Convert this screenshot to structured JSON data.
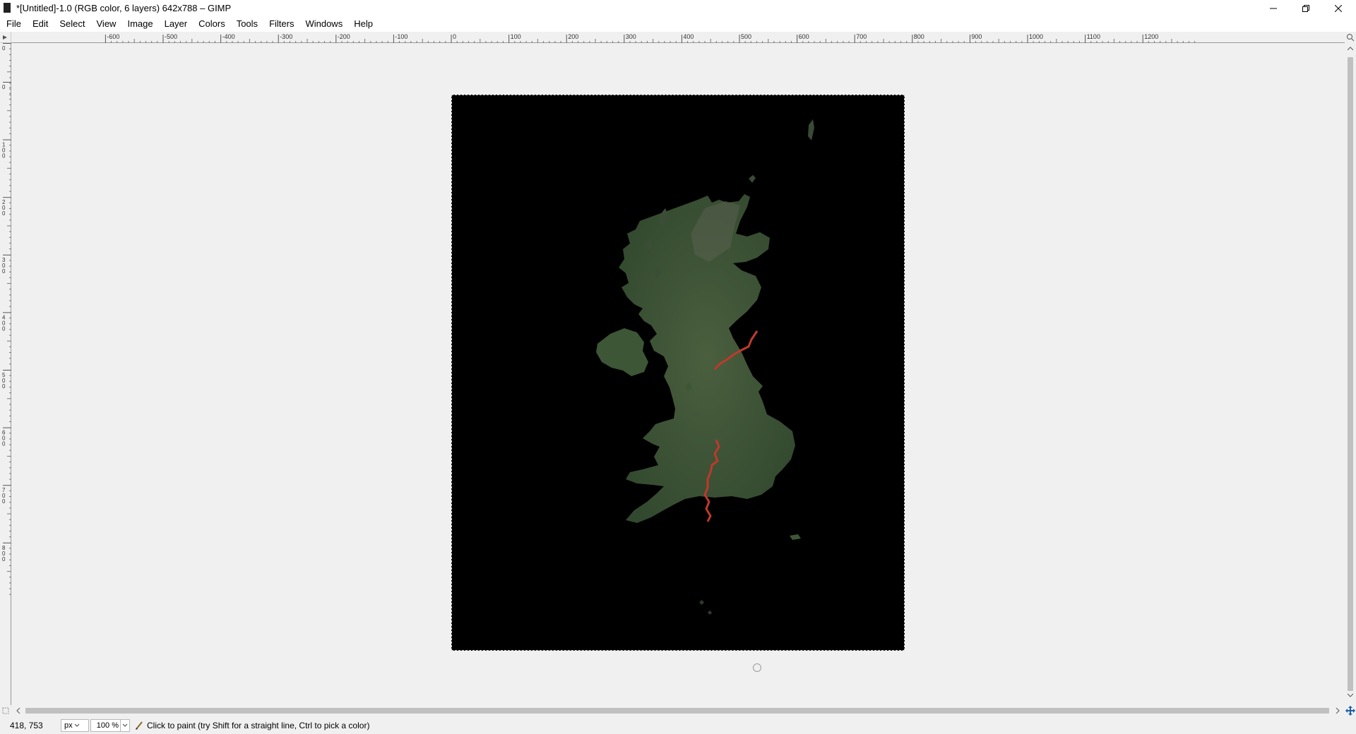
{
  "window": {
    "title": "*[Untitled]-1.0 (RGB color, 6 layers) 642x788 – GIMP",
    "controls": [
      "minimize",
      "maximize",
      "close"
    ]
  },
  "menubar": {
    "items": [
      "File",
      "Edit",
      "Select",
      "View",
      "Image",
      "Layer",
      "Colors",
      "Tools",
      "Filters",
      "Windows",
      "Help"
    ]
  },
  "rulers": {
    "horizontal_ticks": [
      "-600",
      "-500",
      "-400",
      "-300",
      "-200",
      "-100",
      "0",
      "100",
      "200",
      "300",
      "400",
      "500",
      "600",
      "700",
      "800",
      "900",
      "1000",
      "1100",
      "1200"
    ],
    "vertical_ticks": [
      "0",
      "0",
      "100",
      "200",
      "300",
      "400",
      "500",
      "600",
      "700",
      "800"
    ]
  },
  "canvas": {
    "image": "satellite map of Great Britain and Northern Ireland on black background",
    "image_size": "642x788",
    "colors": {
      "background": "#000000",
      "land": "#3b5236",
      "border_line": "#c0392b"
    }
  },
  "statusbar": {
    "coordinates": "418, 753",
    "unit": "px",
    "zoom": "100 %",
    "message": "Click to paint (try Shift for a straight line, Ctrl to pick a color)"
  },
  "icons": {
    "app": "gimp-icon",
    "tool": "pencil-icon",
    "navigate": "navigate-icon",
    "zoom_to_fit": "zoom-fit-icon"
  }
}
